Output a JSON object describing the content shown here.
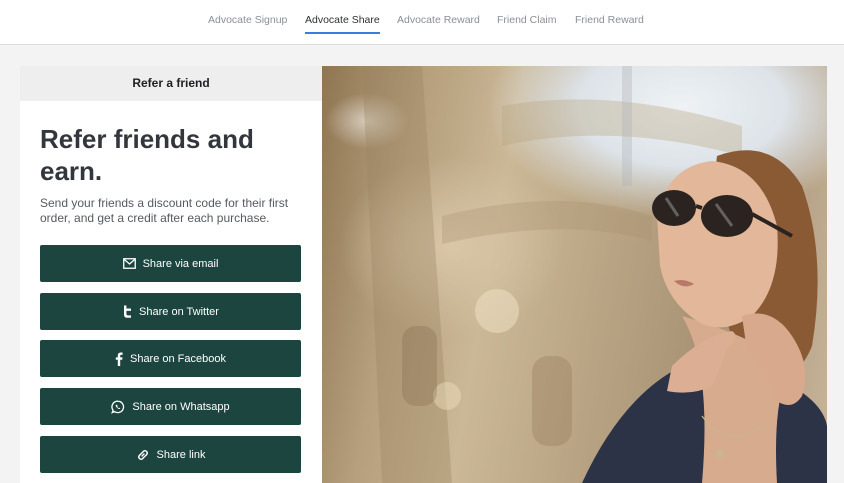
{
  "nav": {
    "tabs": [
      {
        "label": "Advocate Signup",
        "active": false
      },
      {
        "label": "Advocate Share",
        "active": true
      },
      {
        "label": "Advocate Reward",
        "active": false
      },
      {
        "label": "Friend Claim",
        "active": false
      },
      {
        "label": "Friend Reward",
        "active": false
      }
    ]
  },
  "card": {
    "header": "Refer a friend",
    "headline_line1": "Refer friends and",
    "headline_line2": "earn.",
    "subtitle_line1": "Send your friends a discount code for their first",
    "subtitle_line2": "order, and get a credit after each purchase.",
    "buttons": [
      {
        "label": "Share via email",
        "icon": "mail-icon"
      },
      {
        "label": "Share on Twitter",
        "icon": "twitter-icon"
      },
      {
        "label": "Share on Facebook",
        "icon": "facebook-icon"
      },
      {
        "label": "Share on Whatsapp",
        "icon": "whatsapp-icon"
      },
      {
        "label": "Share link",
        "icon": "link-icon"
      }
    ]
  },
  "colors": {
    "button_bg": "#1c4540",
    "tab_underline": "#3b7ddd",
    "headline": "#33363d"
  }
}
